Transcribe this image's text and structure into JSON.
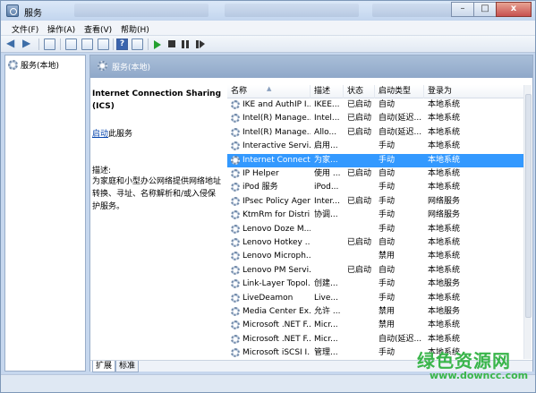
{
  "window": {
    "title": "服务",
    "buttons": {
      "minimize": "–",
      "maximize": "□",
      "close": "x"
    }
  },
  "menubar": {
    "items": [
      {
        "label": "文件(F)"
      },
      {
        "label": "操作(A)"
      },
      {
        "label": "查看(V)"
      },
      {
        "label": "帮助(H)"
      }
    ]
  },
  "toolbar": {
    "icons": [
      "back-icon",
      "forward-icon",
      "show-hide-tree-icon",
      "properties-icon",
      "refresh-icon",
      "export-list-icon",
      "help-icon",
      "show-hide-action-pane-icon",
      "start-service-icon",
      "stop-service-icon",
      "pause-service-icon",
      "restart-service-icon"
    ],
    "help_glyph": "?"
  },
  "tree": {
    "root_label": "服务(本地)"
  },
  "pane": {
    "header_title": "服务(本地)",
    "description": {
      "title": "Internet Connection Sharing (ICS)",
      "start_link": "启动",
      "start_suffix": "此服务",
      "desc_label": "描述:",
      "desc_text": "为家庭和小型办公网络提供网络地址转换、寻址、名称解析和/或入侵保护服务。"
    },
    "columns": {
      "name": "名称",
      "description": "描述",
      "status": "状态",
      "startup_type": "启动类型",
      "logon_as": "登录为"
    },
    "services": [
      {
        "name": "IKE and AuthIP I...",
        "desc": "IKEE...",
        "status": "已启动",
        "start": "自动",
        "logon": "本地系统"
      },
      {
        "name": "Intel(R) Manage...",
        "desc": "Intel...",
        "status": "已启动",
        "start": "自动(延迟...",
        "logon": "本地系统"
      },
      {
        "name": "Intel(R) Manage...",
        "desc": "Allo...",
        "status": "已启动",
        "start": "自动(延迟...",
        "logon": "本地系统"
      },
      {
        "name": "Interactive Servi...",
        "desc": "启用...",
        "status": "",
        "start": "手动",
        "logon": "本地系统"
      },
      {
        "name": "Internet Connect...",
        "desc": "为家...",
        "status": "",
        "start": "手动",
        "logon": "本地系统",
        "selected": true
      },
      {
        "name": "IP Helper",
        "desc": "使用 ...",
        "status": "已启动",
        "start": "自动",
        "logon": "本地系统"
      },
      {
        "name": "iPod 服务",
        "desc": "iPod...",
        "status": "",
        "start": "手动",
        "logon": "本地系统"
      },
      {
        "name": "IPsec Policy Agent",
        "desc": "Inter...",
        "status": "已启动",
        "start": "手动",
        "logon": "网络服务"
      },
      {
        "name": "KtmRm for Distri...",
        "desc": "协调...",
        "status": "",
        "start": "手动",
        "logon": "网络服务"
      },
      {
        "name": "Lenovo Doze M...",
        "desc": "",
        "status": "",
        "start": "手动",
        "logon": "本地系统"
      },
      {
        "name": "Lenovo Hotkey ...",
        "desc": "",
        "status": "已启动",
        "start": "自动",
        "logon": "本地系统"
      },
      {
        "name": "Lenovo Microph...",
        "desc": "",
        "status": "",
        "start": "禁用",
        "logon": "本地系统"
      },
      {
        "name": "Lenovo PM Servi...",
        "desc": "",
        "status": "已启动",
        "start": "自动",
        "logon": "本地系统"
      },
      {
        "name": "Link-Layer Topol...",
        "desc": "创建...",
        "status": "",
        "start": "手动",
        "logon": "本地服务"
      },
      {
        "name": "LiveDeamon",
        "desc": "Live...",
        "status": "",
        "start": "手动",
        "logon": "本地系统"
      },
      {
        "name": "Media Center Ex...",
        "desc": "允许 ...",
        "status": "",
        "start": "禁用",
        "logon": "本地服务"
      },
      {
        "name": "Microsoft .NET F...",
        "desc": "Micr...",
        "status": "",
        "start": "禁用",
        "logon": "本地系统"
      },
      {
        "name": "Microsoft .NET F...",
        "desc": "Micr...",
        "status": "",
        "start": "自动(延迟...",
        "logon": "本地系统"
      },
      {
        "name": "Microsoft iSCSI I...",
        "desc": "管理...",
        "status": "",
        "start": "手动",
        "logon": "本地系统"
      }
    ],
    "tabs": [
      {
        "label": "扩展"
      },
      {
        "label": "标准"
      }
    ]
  },
  "watermark": {
    "main": "绿色资源网",
    "sub": "www.downcc.com"
  },
  "colors": {
    "selection": "#3399ff",
    "header_bg": "#8fa8c9",
    "link": "#0645ad",
    "watermark": "#39b54a"
  }
}
